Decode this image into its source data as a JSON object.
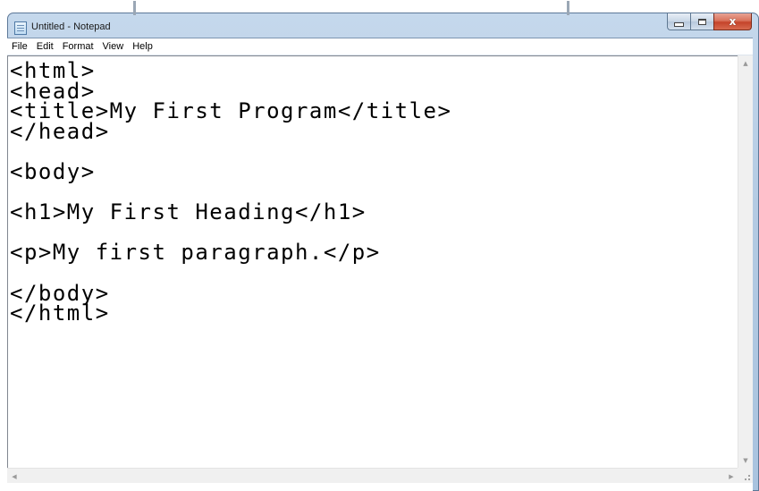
{
  "window": {
    "title": "Untitled - Notepad",
    "caption_close": "x"
  },
  "menu": {
    "items": [
      "File",
      "Edit",
      "Format",
      "View",
      "Help"
    ]
  },
  "editor": {
    "lines": [
      "<html>",
      "<head>",
      "<title>My First Program</title>",
      "</head>",
      "",
      "<body>",
      "",
      "<h1>My First Heading</h1>",
      "",
      "<p>My first paragraph.</p>",
      "",
      "</body>",
      "</html>"
    ]
  },
  "scrollbars": {
    "up_arrow": "▲",
    "down_arrow": "▼",
    "left_arrow": "◀",
    "right_arrow": "▶"
  },
  "icons": {
    "app": "notepad-icon",
    "minimize": "minimize-icon",
    "maximize": "maximize-icon",
    "close": "close-icon"
  }
}
